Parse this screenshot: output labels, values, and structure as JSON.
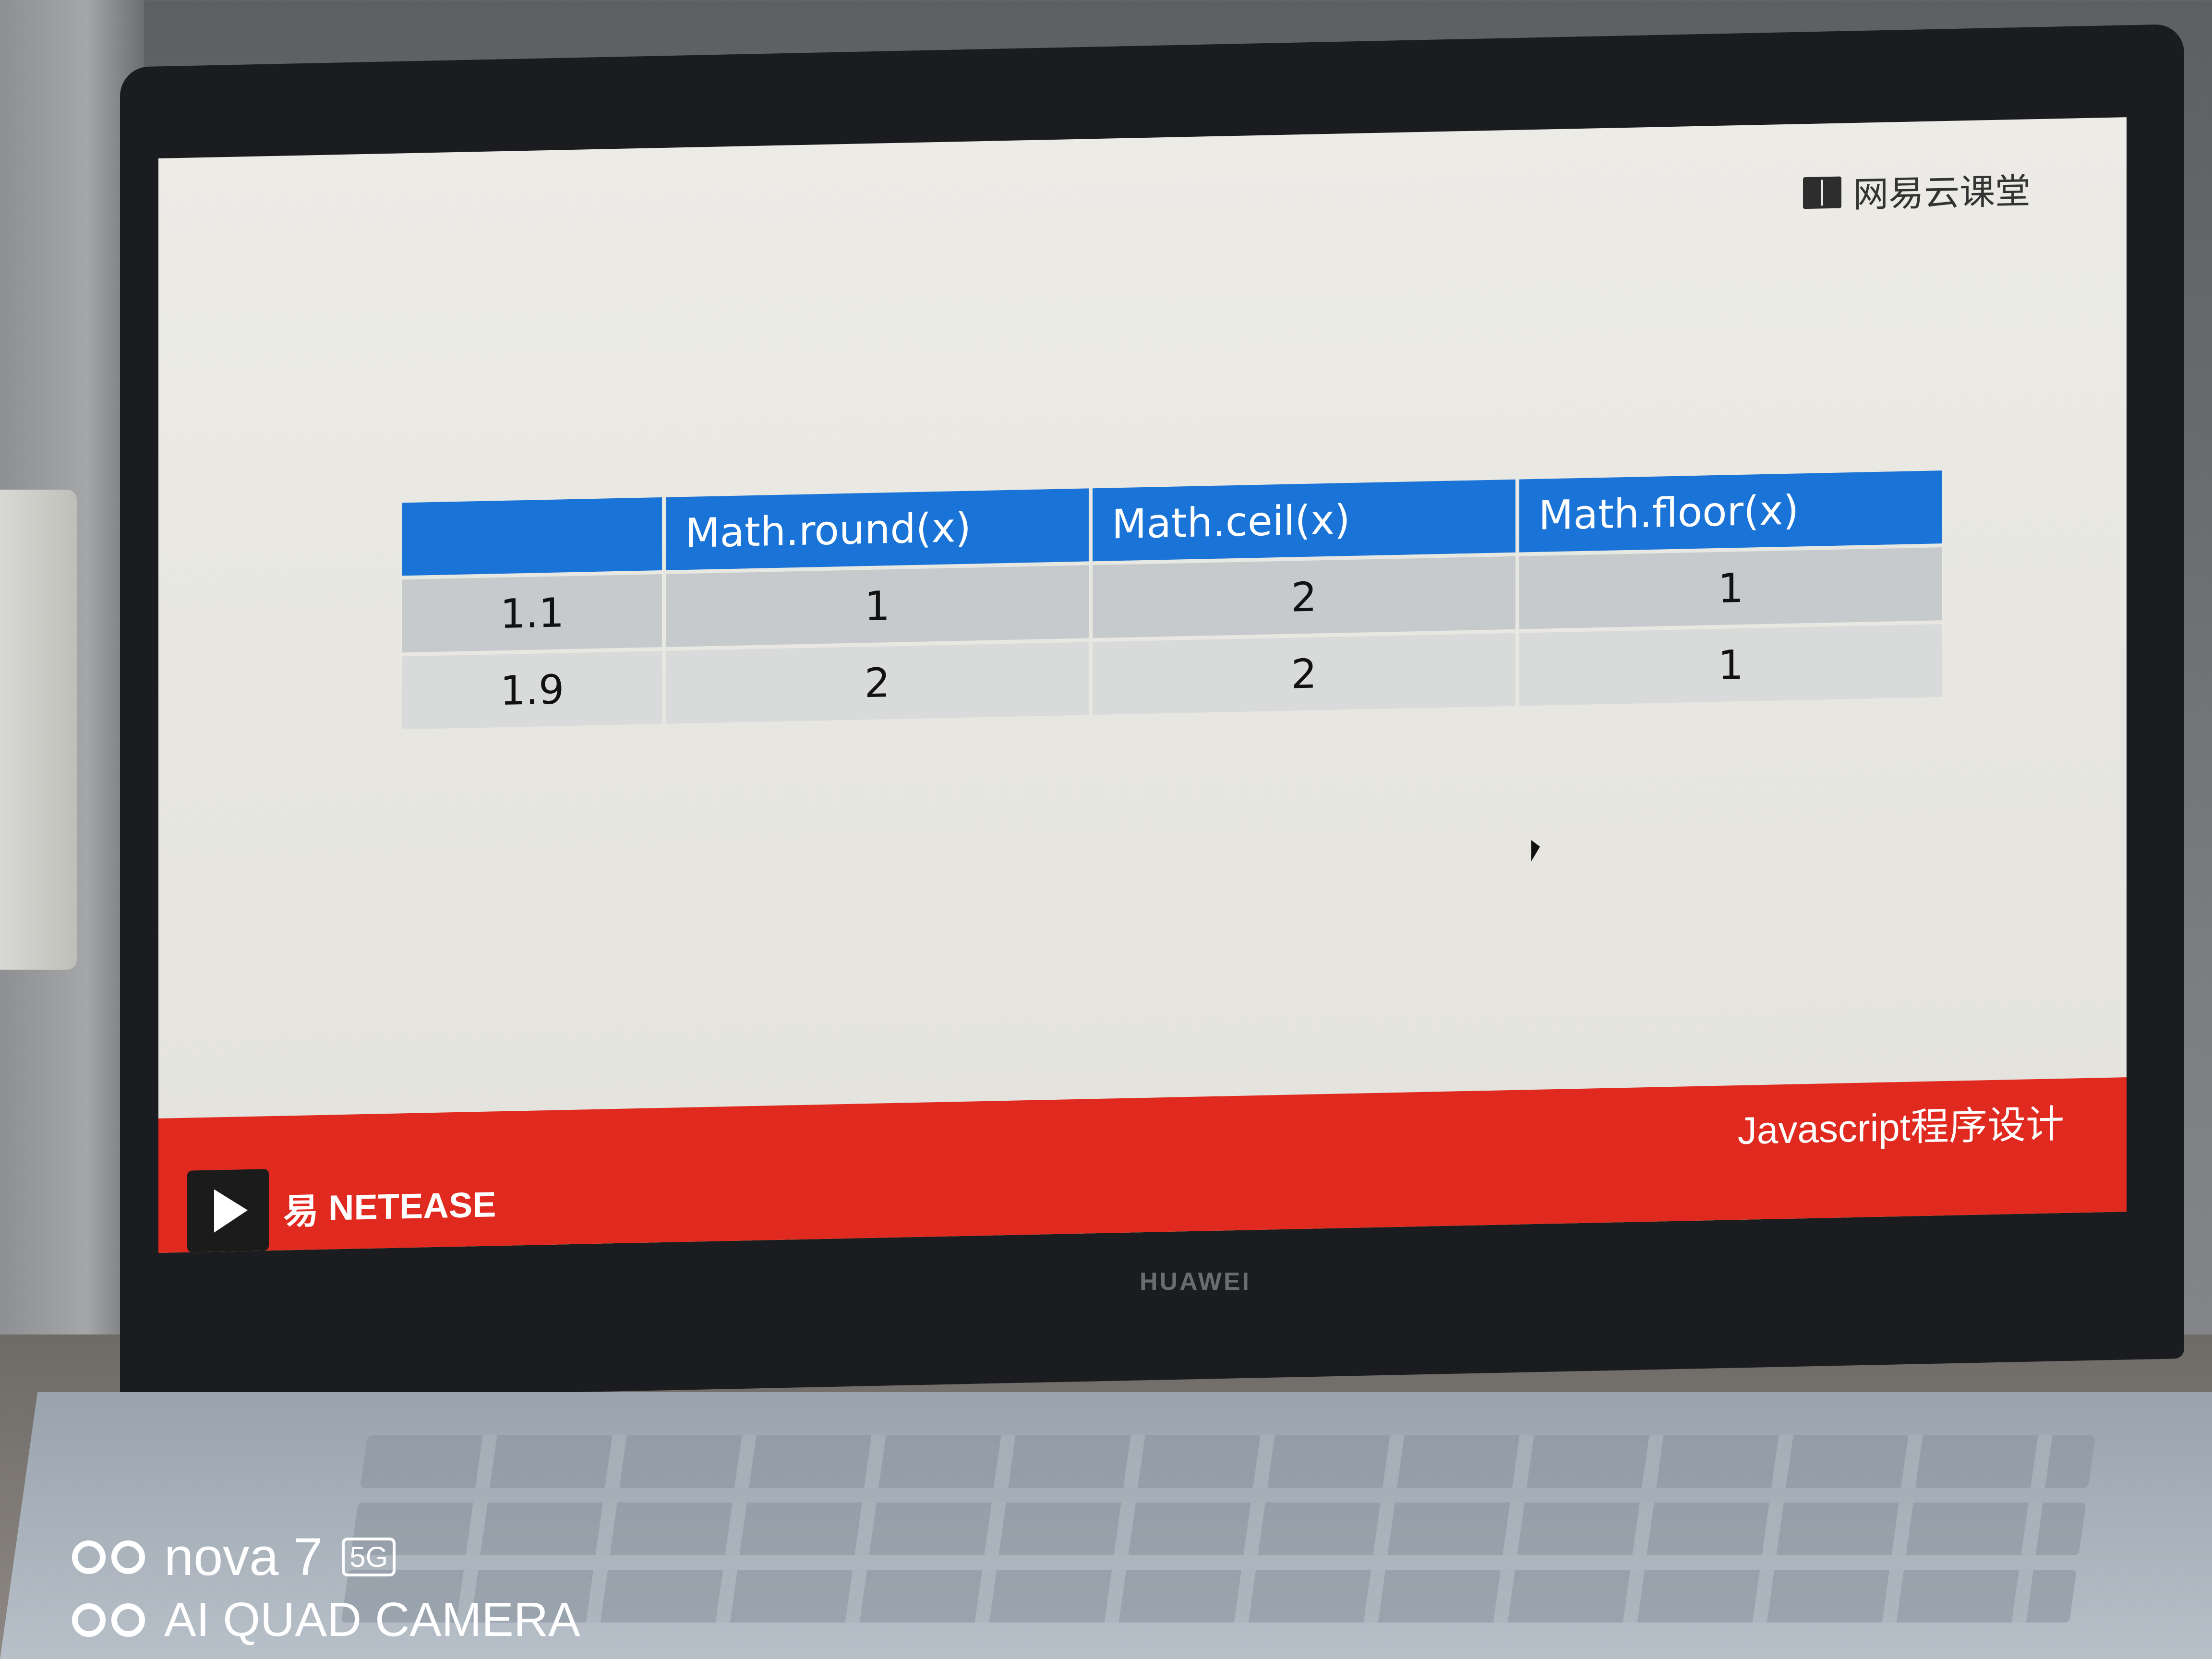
{
  "logo": {
    "text": "网易云课堂"
  },
  "table": {
    "headers": [
      "",
      "Math.round(x)",
      "Math.ceil(x)",
      "Math.floor(x)"
    ],
    "rows": [
      [
        "1.1",
        "1",
        "2",
        "1"
      ],
      [
        "1.9",
        "2",
        "2",
        "1"
      ]
    ]
  },
  "footer": {
    "course_title": "Javascript程序设计",
    "netease_cn": "易",
    "netease_en": "NETEASE"
  },
  "laptop": {
    "brand": "HUAWEI"
  },
  "watermark": {
    "model": "nova 7",
    "badge": "5G",
    "camera": "AI QUAD CAMERA"
  },
  "colors": {
    "header_blue": "#1a73d6",
    "footer_red": "#e02a1f"
  }
}
